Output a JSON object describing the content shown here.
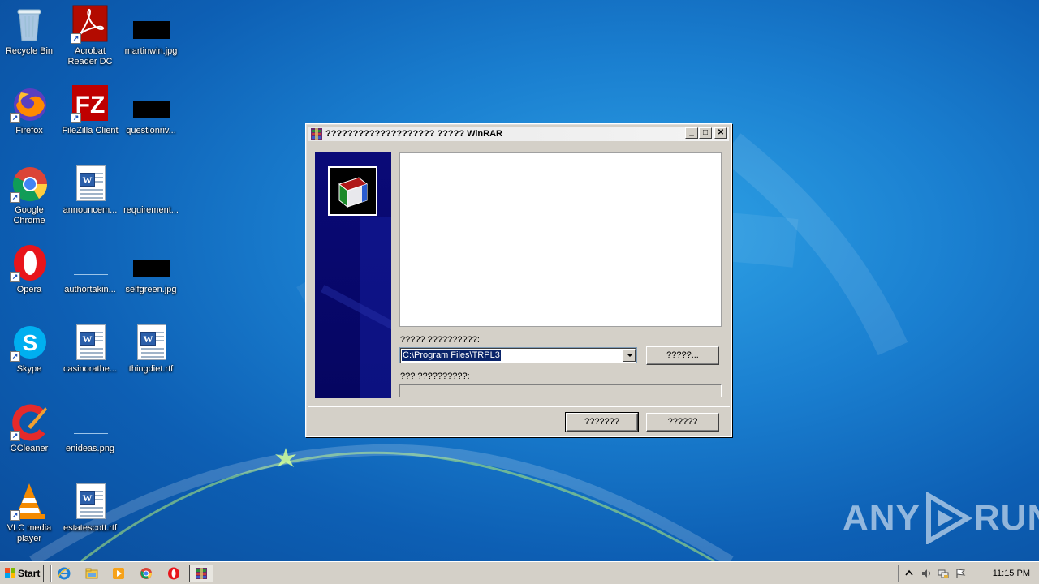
{
  "desktop": {
    "icons": [
      {
        "label": "Recycle Bin"
      },
      {
        "label": "Acrobat Reader DC"
      },
      {
        "label": "martinwin.jpg"
      },
      {
        "label": "Firefox"
      },
      {
        "label": "FileZilla Client"
      },
      {
        "label": "questionriv..."
      },
      {
        "label": "Google Chrome"
      },
      {
        "label": "announcem..."
      },
      {
        "label": "requirement..."
      },
      {
        "label": "Opera"
      },
      {
        "label": "authortakin..."
      },
      {
        "label": "selfgreen.jpg"
      },
      {
        "label": "Skype"
      },
      {
        "label": "casinorathe..."
      },
      {
        "label": "thingdiet.rtf"
      },
      {
        "label": "CCleaner"
      },
      {
        "label": "enideas.png"
      },
      {
        "label": "VLC media player"
      },
      {
        "label": "estatescott.rtf"
      }
    ]
  },
  "dialog": {
    "title": "???????????????????? ????? WinRAR",
    "dest_label": "????? ??????????:",
    "dest_value": "C:\\Program Files\\TRPL3",
    "browse_label": "?????...",
    "progress_label": "??? ??????????:",
    "progress_value": 0,
    "install_label": "???????",
    "cancel_label": "??????",
    "min_glyph": "_",
    "max_glyph": "□",
    "close_glyph": "✕"
  },
  "watermark": {
    "left": "ANY",
    "right": "RUN"
  },
  "taskbar": {
    "start_label": "Start",
    "clock": "11:15 PM",
    "quicklaunch": [
      "ie-icon",
      "explorer-icon",
      "media-player-icon",
      "chrome-icon",
      "opera-icon"
    ],
    "tray": [
      "show-hidden-icon",
      "volume-icon",
      "network-icon",
      "action-center-flag-icon"
    ]
  },
  "colors": {
    "desktop_blue": "#1a7fd0",
    "sidepanel_navy": "#0a0a78",
    "selection_blue": "#0a246a",
    "dialog_gray": "#d4d0c8"
  }
}
